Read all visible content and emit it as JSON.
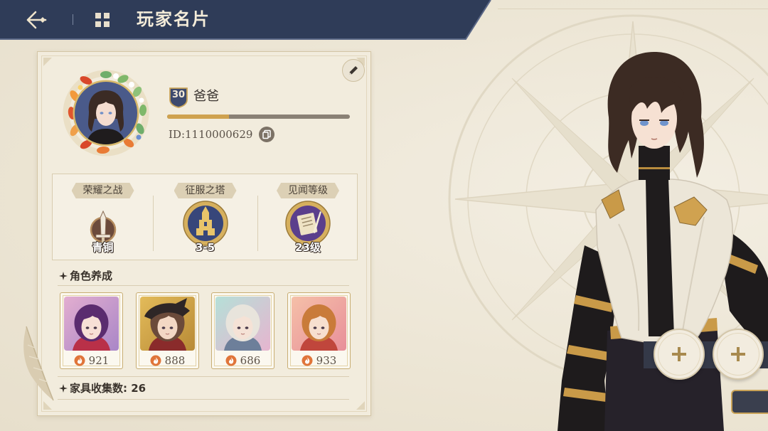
{
  "header": {
    "title": "玩家名片"
  },
  "profile": {
    "level": "30",
    "name": "爸爸",
    "exp_progress": 0.34,
    "id_text": "ID:1110000629"
  },
  "stats": [
    {
      "label": "荣耀之战",
      "value": "青铜",
      "icon": "bronze-sword-rank-icon"
    },
    {
      "label": "征服之塔",
      "value": "3-5",
      "icon": "tower-emblem-icon"
    },
    {
      "label": "见闻等级",
      "value": "23级",
      "icon": "scroll-emblem-icon"
    }
  ],
  "characters": {
    "title": "角色养成",
    "items": [
      {
        "power": "921",
        "icon": "fire-icon"
      },
      {
        "power": "888",
        "icon": "fire-icon"
      },
      {
        "power": "686",
        "icon": "fire-icon"
      },
      {
        "power": "933",
        "icon": "fire-icon"
      }
    ]
  },
  "furniture": {
    "label": "家具收集数: 26"
  },
  "icons": {
    "back": "back-arrow-icon",
    "menu": "grid-menu-icon",
    "edit": "pencil-icon",
    "copy": "copy-icon",
    "add": "plus-icon",
    "bullet": "star-bullet-icon"
  },
  "colors": {
    "header_bg": "#2f3c58",
    "panel_bg": "#f2ecdd",
    "accent_gold": "#c9a257",
    "exp_fill": "#cfa24f",
    "exp_track": "#8a8175",
    "fire": "#e0753a"
  }
}
